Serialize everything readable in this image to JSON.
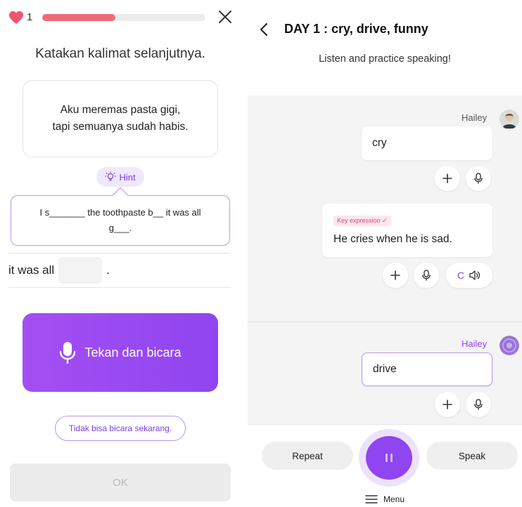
{
  "left": {
    "lives": "1",
    "progress": 0.45,
    "prompt": "Katakan kalimat selanjutnya.",
    "sentence_lines": [
      "Aku meremas pasta gigi,",
      "tapi semuanya sudah habis."
    ],
    "hint_label": "Hint",
    "hint_lines": [
      "I s_______ the toothpaste b__ it was all",
      "g___."
    ],
    "fill_prefix": "it was all",
    "fill_suffix": ".",
    "speak_label": "Tekan dan bicara",
    "cant_speak_label": "Tidak bisa bicara sekarang.",
    "ok_label": "OK",
    "colors": {
      "heart": "#f0556e",
      "progress": "#f06b7a",
      "accent": "#8f45f0"
    }
  },
  "right": {
    "title": "DAY 1 : cry, drive, funny",
    "subtitle": "Listen and practice speaking!",
    "messages": [
      {
        "sender": "Hailey",
        "text": "cry"
      },
      {
        "badge": "Key expression ✓",
        "text": "He cries when he is sad.",
        "playback_label": "C"
      },
      {
        "sender": "Hailey",
        "text": "drive"
      }
    ],
    "repeat_label": "Repeat",
    "speak_label": "Speak",
    "menu_label": "Menu",
    "colors": {
      "accent": "#8f45f0",
      "badge_text": "#e2457a"
    }
  }
}
